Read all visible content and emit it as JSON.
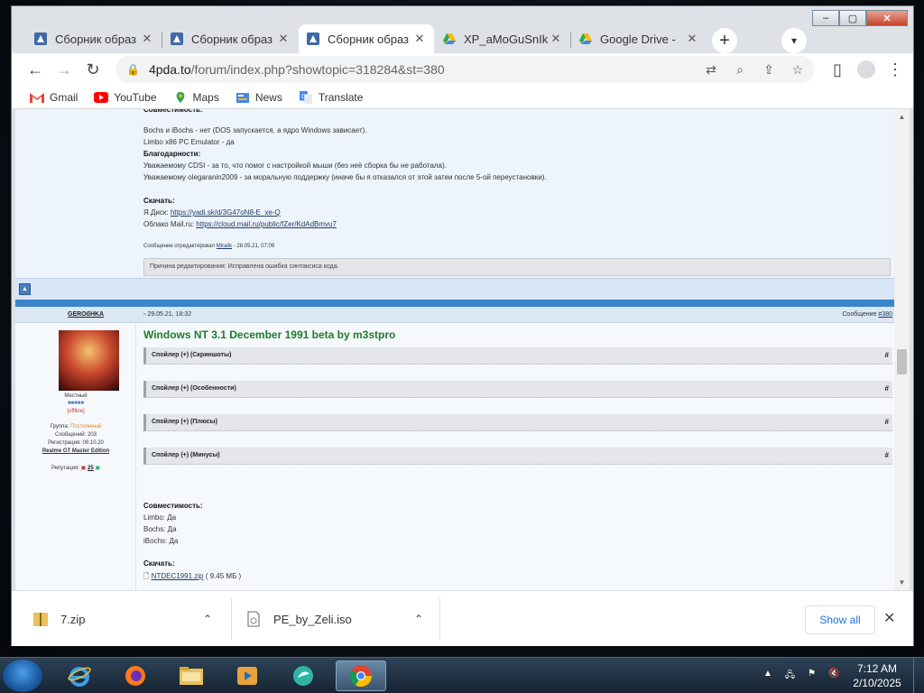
{
  "browser": {
    "tabs": [
      {
        "title": "Сборник образ",
        "favicon": "4pda-icon",
        "active": false
      },
      {
        "title": "Сборник образ",
        "favicon": "4pda-icon",
        "active": false
      },
      {
        "title": "Сборник образ",
        "favicon": "4pda-icon",
        "active": true
      },
      {
        "title": "XP_aMoGuSnIk",
        "favicon": "google-drive-icon",
        "active": false
      },
      {
        "title": "Google Drive - ",
        "favicon": "google-drive-icon",
        "active": false
      }
    ],
    "new_tab_symbol": "+",
    "url_host": "4pda.to",
    "url_path": "/forum/index.php?showtopic=318284&st=380",
    "bookmarks": [
      {
        "label": "Gmail",
        "icon": "gmail-icon"
      },
      {
        "label": "YouTube",
        "icon": "youtube-icon"
      },
      {
        "label": "Maps",
        "icon": "maps-icon"
      },
      {
        "label": "News",
        "icon": "news-icon"
      },
      {
        "label": "Translate",
        "icon": "translate-icon"
      }
    ]
  },
  "post1": {
    "lines": [
      "Bochs и iBochs - нет (DOS запускается, а ядро Windows зависает).",
      "Limbo x86 PC Emulator - да"
    ],
    "thanks_heading": "Благодарности:",
    "thanks": [
      "Уважаемому CDSI - за то, что помог с настройкой мыши (без неё сборка бы не работала).",
      "Уважаемому olegaranin2009 - за моральную поддержку (иначе бы я отказался от этой затеи после 5-ой переустановки)."
    ],
    "download_heading": "Скачать:",
    "yadisk_label": "Я.Диск:",
    "yadisk_link": "https://yadi.sk/d/3G47oN8-E_xe-Q",
    "mailru_label": "Облако Mail.ru:",
    "mailru_link": "https://cloud.mail.ru/public/fZer/KdAdBmvu7",
    "edited_prefix": "Сообщение отредактировал",
    "edited_user": "Miralik",
    "edited_time": "- 28.05.21, 07:09",
    "edit_reason": "Причина редактирования: Исправлена ошибка синтаксиса кода."
  },
  "post2": {
    "author": "GEROбHKA",
    "date": "29.05.21, 18:32",
    "msg_label": "Сообщение",
    "msg_number": "#380",
    "title": "Windows NT 3.1 December 1991 beta by m3stpro",
    "rank": "Местный",
    "status": "[offline]",
    "group_label": "Группа:",
    "group_value": "Постоянный",
    "posts_line": "Сообщений: 203",
    "reg_line": "Регистрация: 09.10.20",
    "device": "Realme GT Master Edition",
    "rep_label": "Репутация:",
    "rep_value": "25",
    "spoilers": [
      "Спойлер (+) (Скриншоты)",
      "Спойлер (+) (Особенности)",
      "Спойлер (+) (Плюсы)",
      "Спойлер (+) (Минусы)"
    ],
    "spoiler_hash": "#",
    "compat_heading": "Совместимость:",
    "compat": [
      "Limbo: Да",
      "Bochs: Да",
      "iBochs: Да"
    ],
    "download_heading": "Скачать:",
    "file_name": "NTDEC1991.zip",
    "file_size": "( 9.45 МБ )"
  },
  "downloads": {
    "items": [
      "7.zip",
      "PE_by_Zeli.iso"
    ],
    "show_all": "Show all"
  },
  "taskbar": {
    "time": "7:12 AM",
    "date": "2/10/2025"
  },
  "colors": {
    "forum_blue": "#3a84c9",
    "post_title_green": "#1e7b2b",
    "group_orange": "#e08a1e"
  }
}
